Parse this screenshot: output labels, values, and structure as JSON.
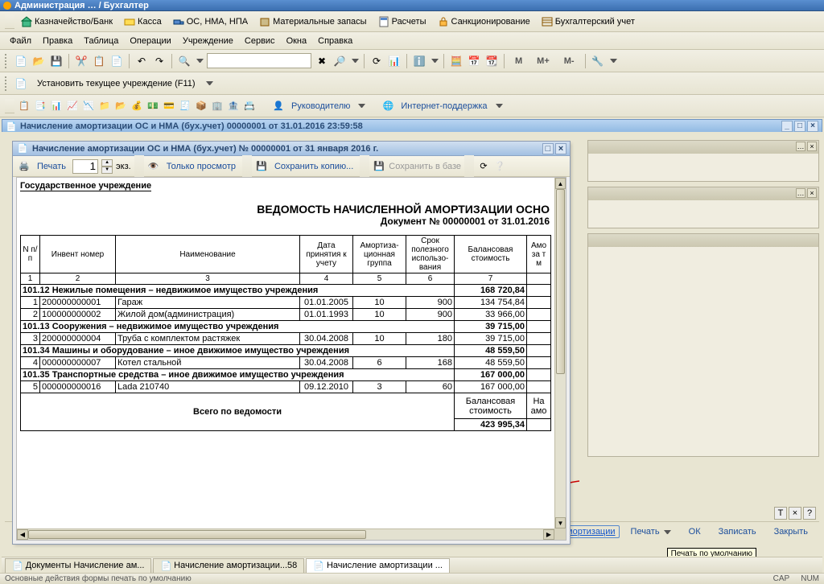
{
  "app_title": "Администрация … / Бухгалтер",
  "modules": {
    "cash": "Касса",
    "treasury": "Казначейство/Банк",
    "os": "ОС, НМА, НПА",
    "inventory": "Материальные запасы",
    "calc": "Расчеты",
    "sanction": "Санкционирование",
    "accounting": "Бухгалтерский учет"
  },
  "menu": {
    "file": "Файл",
    "edit": "Правка",
    "table": "Таблица",
    "ops": "Операции",
    "org": "Учреждение",
    "service": "Сервис",
    "windows": "Окна",
    "help": "Справка"
  },
  "toolbar": {
    "m": "М",
    "mplus": "М+",
    "mminus": "М-",
    "set_current_org": "Установить текущее учреждение (F11)",
    "manager": "Руководителю",
    "internet": "Интернет-поддержка"
  },
  "mdi_title": "Начисление амортизации ОС и НМА (бух.учет) 00000001 от 31.01.2016 23:59:58",
  "doc_title": "Начисление амортизации ОС и НМА (бух.учет) № 00000001 от 31 января 2016 г.",
  "doc_tb": {
    "print": "Печать",
    "copies": "1",
    "copies_unit": "экз.",
    "preview_only": "Только просмотр",
    "save_copy": "Сохранить копию...",
    "save_db": "Сохранить в базе"
  },
  "report": {
    "header": "Государственное учреждение",
    "title": "ВЕДОМОСТЬ НАЧИСЛЕННОЙ АМОРТИЗАЦИИ ОСНО",
    "subtitle": "Документ № 00000001 от 31.01.2016",
    "cols": {
      "n": "N п/п",
      "inv": "Инвент номер",
      "name": "Наименование",
      "date": "Дата принятия к учету",
      "grp": "Амортиза-\nционная группа",
      "term": "Срок полезного использо-\nвания",
      "balance": "Балансовая стоимость",
      "amort": "Амо\nза т\nм"
    },
    "hnums": [
      "1",
      "2",
      "3",
      "4",
      "5",
      "6",
      "7"
    ],
    "g1": {
      "title": "101.12 Нежилые помещения – недвижимое имущество учреждения",
      "bal": "168 720,84"
    },
    "r1": {
      "n": "1",
      "inv": "200000000001",
      "name": "Гараж",
      "date": "01.01.2005",
      "grp": "10",
      "term": "900",
      "bal": "134 754,84"
    },
    "r2": {
      "n": "2",
      "inv": "100000000002",
      "name": "Жилой дом(администрация)",
      "date": "01.01.1993",
      "grp": "10",
      "term": "900",
      "bal": "33 966,00"
    },
    "g2": {
      "title": "101.13 Сооружения – недвижимое имущество учреждения",
      "bal": "39 715,00"
    },
    "r3": {
      "n": "3",
      "inv": "200000000004",
      "name": "Труба с комплектом растяжек",
      "date": "30.04.2008",
      "grp": "10",
      "term": "180",
      "bal": "39 715,00"
    },
    "g3": {
      "title": "101.34 Машины и оборудование – иное движимое имущество учреждения",
      "bal": "48 559,50"
    },
    "r4": {
      "n": "4",
      "inv": "000000000007",
      "name": "Котел стальной",
      "date": "30.04.2008",
      "grp": "6",
      "term": "168",
      "bal": "48 559,50"
    },
    "g4": {
      "title": "101.35 Транспортные средства – иное движимое имущество учреждения",
      "bal": "167 000,00"
    },
    "r5": {
      "n": "5",
      "inv": "000000000016",
      "name": "Lada 210740",
      "date": "09.12.2010",
      "grp": "3",
      "term": "60",
      "bal": "167 000,00"
    },
    "total_label": "Всего по ведомости",
    "total_bal_lbl": "Балансовая стоимость",
    "total_amo_lbl": "На\nамо",
    "total_bal": "423 995,34"
  },
  "actions": {
    "vedomost": "Ведомость начисленной амортизации",
    "print": "Печать",
    "ok": "ОК",
    "save": "Записать",
    "close": "Закрыть",
    "tx": "Т"
  },
  "tabs": {
    "t1": "Документы Начисление ам...",
    "t2": "Начисление амортизации...58",
    "t3": "Начисление амортизации ..."
  },
  "status": {
    "left": "Основные действия формы печать по умолчанию",
    "cap": "CAP",
    "num": "NUM"
  },
  "tooltip": "Печать по умолчанию"
}
